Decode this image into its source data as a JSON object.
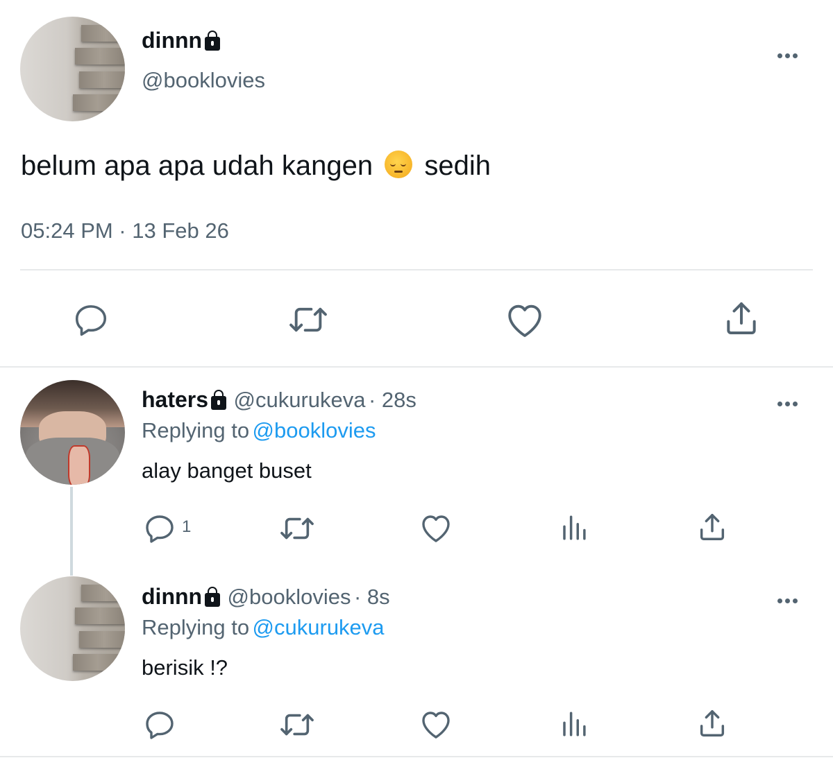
{
  "main_tweet": {
    "name": "dinnn",
    "handle": "@booklovies",
    "text_before_emoji": "belum apa apa udah kangen",
    "emoji": "pensive-face-emoji",
    "text_after_emoji": "sedih",
    "timestamp": "05:24 PM · 13 Feb 26",
    "actions": [
      "reply-icon",
      "retweet-icon",
      "like-icon",
      "share-icon"
    ]
  },
  "replies": [
    {
      "name": "haters",
      "handle": "@cukurukeva",
      "time": "· 28s",
      "replying_label": "Replying to",
      "replying_to": "@booklovies",
      "text": "alay banget buset",
      "reply_count": "1"
    },
    {
      "name": "dinnn",
      "handle": "@booklovies",
      "time": "· 8s",
      "replying_label": "Replying to",
      "replying_to": "@cukurukeva",
      "text": "berisik !?",
      "reply_count": ""
    }
  ],
  "colors": {
    "text": "#0f1419",
    "muted": "#536471",
    "link": "#1d9bf0",
    "divider": "#e7e9ea"
  }
}
